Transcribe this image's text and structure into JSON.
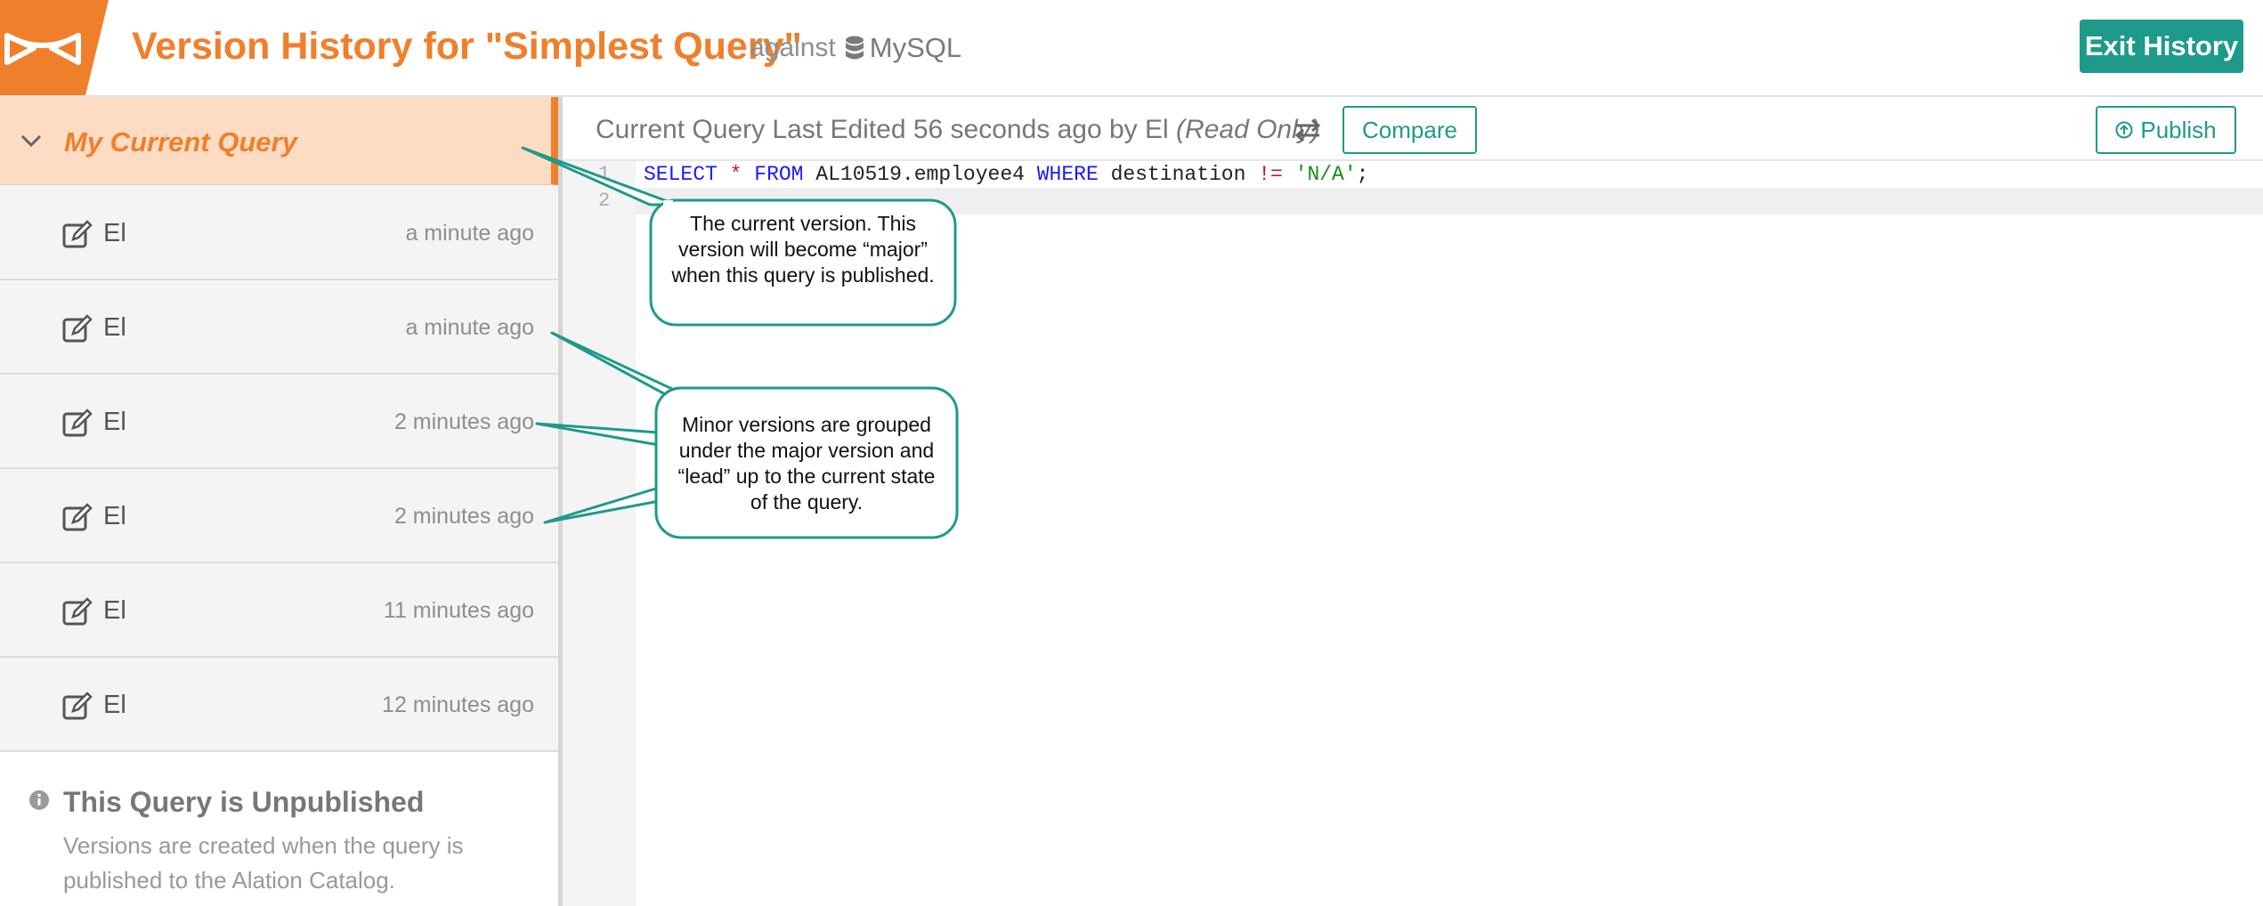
{
  "header": {
    "title": "Version History for \"Simplest Query\"",
    "against_label": "against",
    "db_name": "MySQL",
    "exit_label": "Exit History"
  },
  "sidebar": {
    "current_label": "My Current Query",
    "versions": [
      {
        "author": "El",
        "time": "a minute ago"
      },
      {
        "author": "El",
        "time": "a minute ago"
      },
      {
        "author": "El",
        "time": "2 minutes ago"
      },
      {
        "author": "El",
        "time": "2 minutes ago"
      },
      {
        "author": "El",
        "time": "11 minutes ago"
      },
      {
        "author": "El",
        "time": "12 minutes ago"
      }
    ],
    "unpublished_title": "This Query is Unpublished",
    "unpublished_desc": "Versions are created when the query is published to the Alation Catalog."
  },
  "toolbar": {
    "status": "Current Query Last Edited 56 seconds ago by El",
    "read_only": "(Read Only)",
    "compare_label": "Compare",
    "publish_label": "Publish"
  },
  "editor": {
    "line_numbers": [
      "1",
      "2"
    ],
    "tokens": {
      "select": "SELECT",
      "star": "*",
      "from": "FROM",
      "table": "AL10519.employee4",
      "where": "WHERE",
      "column": "destination",
      "neq": "!=",
      "value": "'N/A'",
      "semicolon": ";"
    }
  },
  "callouts": {
    "current": "The current version. This version will become “major” when this query is published.",
    "minor": "Minor versions are grouped under the major version and “lead” up to the current state of the query."
  },
  "colors": {
    "brand_orange": "#f07f2b",
    "accent_teal": "#1e9a8a",
    "current_bg": "#fedcc3"
  }
}
